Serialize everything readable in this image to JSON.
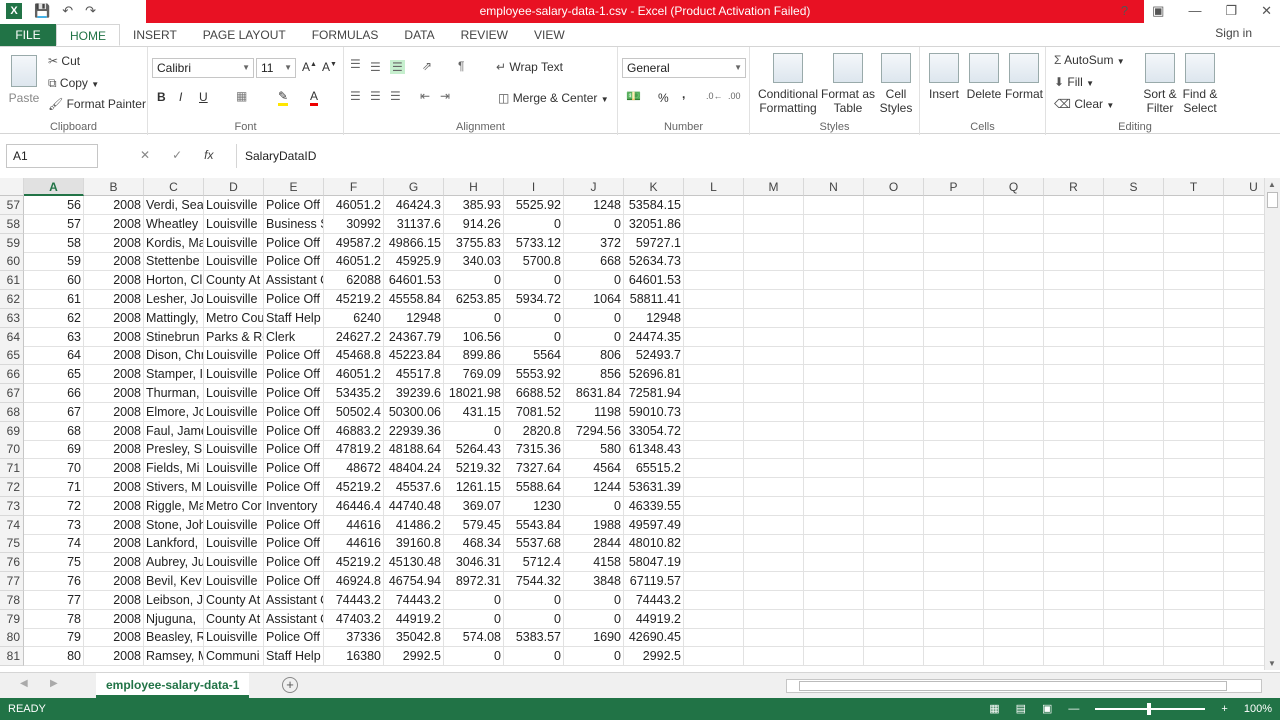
{
  "window": {
    "title": "employee-salary-data-1.csv -  Excel (Product Activation Failed)",
    "help": "?",
    "signin": "Sign in"
  },
  "tabs": [
    "FILE",
    "HOME",
    "INSERT",
    "PAGE LAYOUT",
    "FORMULAS",
    "DATA",
    "REVIEW",
    "VIEW"
  ],
  "ribbon": {
    "clipboard": {
      "label": "Clipboard",
      "paste": "Paste",
      "cut": "Cut",
      "copy": "Copy",
      "format_painter": "Format Painter"
    },
    "font": {
      "label": "Font",
      "family": "Calibri",
      "size": "11",
      "bold": "B",
      "italic": "I",
      "underline": "U"
    },
    "alignment": {
      "label": "Alignment",
      "wrap": "Wrap Text",
      "merge": "Merge & Center"
    },
    "number": {
      "label": "Number",
      "format": "General",
      "percent": "%",
      "comma": ","
    },
    "styles": {
      "label": "Styles",
      "conditional": "Conditional Formatting",
      "format_table": "Format as Table",
      "cell_styles": "Cell Styles"
    },
    "cells": {
      "label": "Cells",
      "insert": "Insert",
      "delete": "Delete",
      "format": "Format"
    },
    "editing": {
      "label": "Editing",
      "autosum": "AutoSum",
      "fill": "Fill",
      "clear": "Clear",
      "sort": "Sort & Filter",
      "find": "Find & Select"
    }
  },
  "formula_bar": {
    "name_box": "A1",
    "fx": "fx",
    "content": "SalaryDataID"
  },
  "columns": [
    "A",
    "B",
    "C",
    "D",
    "E",
    "F",
    "G",
    "H",
    "I",
    "J",
    "K",
    "L",
    "M",
    "N",
    "O",
    "P",
    "Q",
    "R",
    "S",
    "T",
    "U"
  ],
  "rows": [
    {
      "r": "57",
      "c": [
        "56",
        "2008",
        "Verdi, Sea",
        "Louisville",
        "Police Off",
        "46051.2",
        "46424.3",
        "385.93",
        "5525.92",
        "1248",
        "53584.15"
      ]
    },
    {
      "r": "58",
      "c": [
        "57",
        "2008",
        "Wheatley",
        "Louisville",
        "Business S",
        "30992",
        "31137.6",
        "914.26",
        "0",
        "0",
        "32051.86"
      ]
    },
    {
      "r": "59",
      "c": [
        "58",
        "2008",
        "Kordis, Ma",
        "Louisville",
        "Police Off",
        "49587.2",
        "49866.15",
        "3755.83",
        "5733.12",
        "372",
        "59727.1"
      ]
    },
    {
      "r": "60",
      "c": [
        "59",
        "2008",
        "Stettenbe",
        "Louisville",
        "Police Off",
        "46051.2",
        "45925.9",
        "340.03",
        "5700.8",
        "668",
        "52634.73"
      ]
    },
    {
      "r": "61",
      "c": [
        "60",
        "2008",
        "Horton, Cl",
        "County At",
        "Assistant C",
        "62088",
        "64601.53",
        "0",
        "0",
        "0",
        "64601.53"
      ]
    },
    {
      "r": "62",
      "c": [
        "61",
        "2008",
        "Lesher, Jo",
        "Louisville",
        "Police Off",
        "45219.2",
        "45558.84",
        "6253.85",
        "5934.72",
        "1064",
        "58811.41"
      ]
    },
    {
      "r": "63",
      "c": [
        "62",
        "2008",
        "Mattingly,",
        "Metro Cou",
        "Staff Help",
        "6240",
        "12948",
        "0",
        "0",
        "0",
        "12948"
      ]
    },
    {
      "r": "64",
      "c": [
        "63",
        "2008",
        "Stinebrun",
        "Parks & Re",
        "Clerk",
        "24627.2",
        "24367.79",
        "106.56",
        "0",
        "0",
        "24474.35"
      ]
    },
    {
      "r": "65",
      "c": [
        "64",
        "2008",
        "Dison, Chr",
        "Louisville",
        "Police Off",
        "45468.8",
        "45223.84",
        "899.86",
        "5564",
        "806",
        "52493.7"
      ]
    },
    {
      "r": "66",
      "c": [
        "65",
        "2008",
        "Stamper, I",
        "Louisville",
        "Police Off",
        "46051.2",
        "45517.8",
        "769.09",
        "5553.92",
        "856",
        "52696.81"
      ]
    },
    {
      "r": "67",
      "c": [
        "66",
        "2008",
        "Thurman,",
        "Louisville",
        "Police Off",
        "53435.2",
        "39239.6",
        "18021.98",
        "6688.52",
        "8631.84",
        "72581.94"
      ]
    },
    {
      "r": "68",
      "c": [
        "67",
        "2008",
        "Elmore, Jo",
        "Louisville",
        "Police Off",
        "50502.4",
        "50300.06",
        "431.15",
        "7081.52",
        "1198",
        "59010.73"
      ]
    },
    {
      "r": "69",
      "c": [
        "68",
        "2008",
        "Faul, Jame",
        "Louisville",
        "Police Off",
        "46883.2",
        "22939.36",
        "0",
        "2820.8",
        "7294.56",
        "33054.72"
      ]
    },
    {
      "r": "70",
      "c": [
        "69",
        "2008",
        "Presley, S",
        "Louisville",
        "Police Off",
        "47819.2",
        "48188.64",
        "5264.43",
        "7315.36",
        "580",
        "61348.43"
      ]
    },
    {
      "r": "71",
      "c": [
        "70",
        "2008",
        "Fields, Mi",
        "Louisville",
        "Police Off",
        "48672",
        "48404.24",
        "5219.32",
        "7327.64",
        "4564",
        "65515.2"
      ]
    },
    {
      "r": "72",
      "c": [
        "71",
        "2008",
        "Stivers, M",
        "Louisville",
        "Police Off",
        "45219.2",
        "45537.6",
        "1261.15",
        "5588.64",
        "1244",
        "53631.39"
      ]
    },
    {
      "r": "73",
      "c": [
        "72",
        "2008",
        "Riggle, Ma",
        "Metro Cor",
        "Inventory",
        "46446.4",
        "44740.48",
        "369.07",
        "1230",
        "0",
        "46339.55"
      ]
    },
    {
      "r": "74",
      "c": [
        "73",
        "2008",
        "Stone, Joh",
        "Louisville",
        "Police Off",
        "44616",
        "41486.2",
        "579.45",
        "5543.84",
        "1988",
        "49597.49"
      ]
    },
    {
      "r": "75",
      "c": [
        "74",
        "2008",
        "Lankford,",
        "Louisville",
        "Police Off",
        "44616",
        "39160.8",
        "468.34",
        "5537.68",
        "2844",
        "48010.82"
      ]
    },
    {
      "r": "76",
      "c": [
        "75",
        "2008",
        "Aubrey, Ju",
        "Louisville",
        "Police Off",
        "45219.2",
        "45130.48",
        "3046.31",
        "5712.4",
        "4158",
        "58047.19"
      ]
    },
    {
      "r": "77",
      "c": [
        "76",
        "2008",
        "Bevil, Kev",
        "Louisville",
        "Police Off",
        "46924.8",
        "46754.94",
        "8972.31",
        "7544.32",
        "3848",
        "67119.57"
      ]
    },
    {
      "r": "78",
      "c": [
        "77",
        "2008",
        "Leibson, J",
        "County At",
        "Assistant C",
        "74443.2",
        "74443.2",
        "0",
        "0",
        "0",
        "74443.2"
      ]
    },
    {
      "r": "79",
      "c": [
        "78",
        "2008",
        "Njuguna,",
        "County At",
        "Assistant C",
        "47403.2",
        "44919.2",
        "0",
        "0",
        "0",
        "44919.2"
      ]
    },
    {
      "r": "80",
      "c": [
        "79",
        "2008",
        "Beasley, R",
        "Louisville",
        "Police Off",
        "37336",
        "35042.8",
        "574.08",
        "5383.57",
        "1690",
        "42690.45"
      ]
    },
    {
      "r": "81",
      "c": [
        "80",
        "2008",
        "Ramsey, M",
        "Communi",
        "Staff Help",
        "16380",
        "2992.5",
        "0",
        "0",
        "0",
        "2992.5"
      ]
    }
  ],
  "sheet": {
    "name": "employee-salary-data-1",
    "add": "+"
  },
  "status": {
    "ready": "READY",
    "zoom": "100%"
  }
}
